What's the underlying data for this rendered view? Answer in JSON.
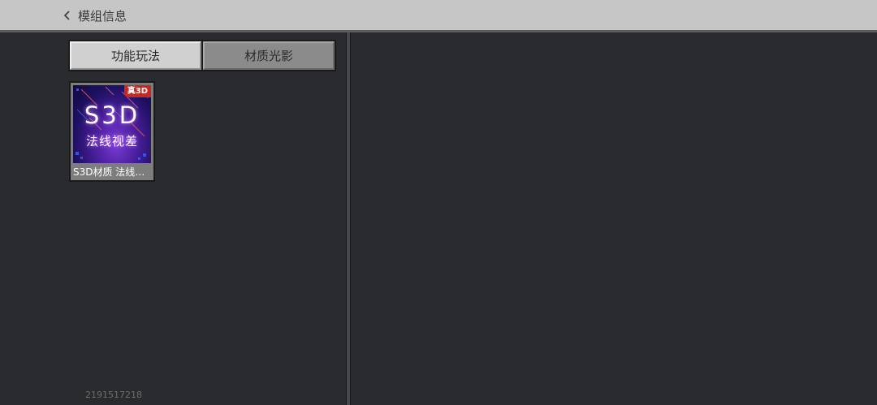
{
  "header": {
    "back_icon": "chevron-left-icon",
    "title": "模组信息"
  },
  "tabs": [
    {
      "label": "功能玩法",
      "active": false
    },
    {
      "label": "材质光影",
      "active": true
    }
  ],
  "items": [
    {
      "badge": "真3D",
      "thumb_title": "S3D",
      "thumb_subtitle": "法线视差",
      "label": "S3D材质 法线…"
    }
  ],
  "footer": {
    "id_text": "2191517218"
  },
  "colors": {
    "topbar": "#c6c6c6",
    "background": "#2a2b2e",
    "tab_active": "#8b8b8b",
    "tab_inactive": "#d0d0d0",
    "badge": "#c8281f"
  }
}
